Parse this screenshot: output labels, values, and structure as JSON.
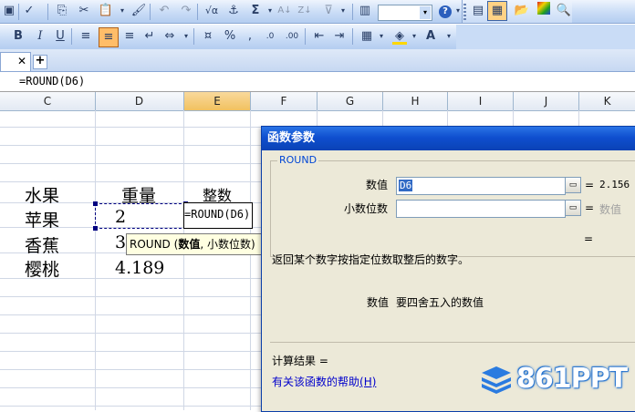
{
  "formula_bar": {
    "formula": "=ROUND(D6)"
  },
  "sheet_tabs": {
    "close_glyph": "✕",
    "add_glyph": "+"
  },
  "toolbar": {
    "sum_glyph": "Σ",
    "font_color": "#e8a000",
    "highlight_color": "#ffd700",
    "text_color": "#cc0000"
  },
  "columns": [
    "C",
    "D",
    "E",
    "F",
    "G",
    "H",
    "I",
    "J",
    "K"
  ],
  "selected_column": "E",
  "cells": {
    "header_fruit": "水果",
    "header_weight": "重量",
    "header_integer": "整数",
    "row1_fruit": "苹果",
    "row1_weight": "2",
    "row1_formula": "=ROUND(D6)",
    "row2_fruit": "香蕉",
    "row2_weight": "3",
    "row3_fruit": "樱桃",
    "row3_weight": "4.189"
  },
  "tooltip": {
    "func": "ROUND",
    "args_open": "(",
    "arg1": "数值",
    "sep": ",",
    "arg2": "小数位数",
    "args_close": ")"
  },
  "dialog": {
    "title": "函数参数",
    "group_label": "ROUND",
    "arg1_label": "数值",
    "arg1_value": "D6",
    "arg1_result": "2.156",
    "arg2_label": "小数位数",
    "arg2_value": "",
    "arg2_result": "数值",
    "eq": "=",
    "result_eq": "=",
    "description": "返回某个数字按指定位数取整后的数字。",
    "arg_help_name": "数值",
    "arg_help_text": "要四舍五入的数值",
    "result_label": "计算结果 =",
    "help_link": "有关该函数的帮助",
    "help_hotkey": "(H)"
  },
  "watermark": {
    "text": "861PPT"
  },
  "colors": {
    "title_bar": "#0f4fcf",
    "selected_col_header": "#f1c15f",
    "selection_border": "#000080",
    "link": "#0000cc"
  }
}
